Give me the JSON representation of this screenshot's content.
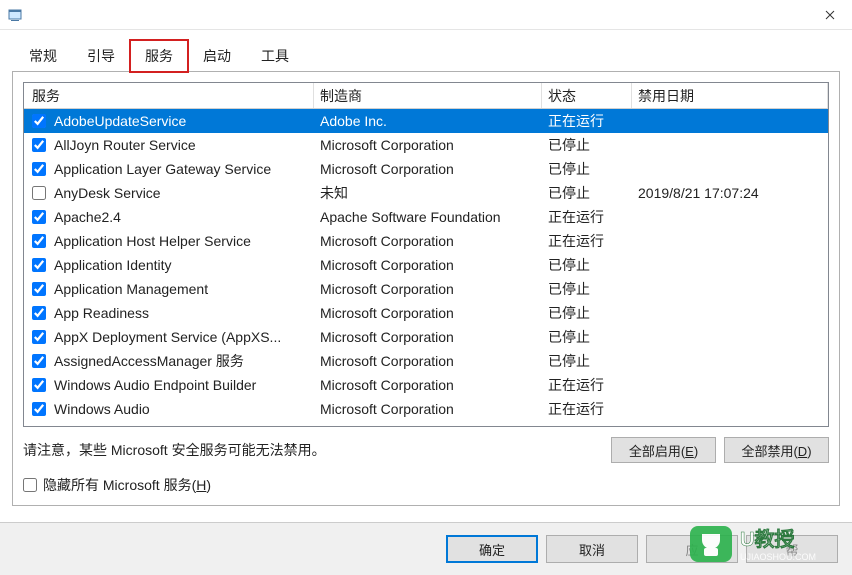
{
  "titlebar": {
    "close_tooltip": "Close"
  },
  "tabs": {
    "items": [
      {
        "label": "常规"
      },
      {
        "label": "引导"
      },
      {
        "label": "服务"
      },
      {
        "label": "启动"
      },
      {
        "label": "工具"
      }
    ],
    "active_index": 2,
    "highlighted_index": 2
  },
  "columns": {
    "service": "服务",
    "vendor": "制造商",
    "status": "状态",
    "disabled_date": "禁用日期"
  },
  "services": [
    {
      "checked": true,
      "selected": true,
      "name": "AdobeUpdateService",
      "vendor": "Adobe Inc.",
      "status": "正在运行",
      "date": ""
    },
    {
      "checked": true,
      "selected": false,
      "name": "AllJoyn Router Service",
      "vendor": "Microsoft Corporation",
      "status": "已停止",
      "date": ""
    },
    {
      "checked": true,
      "selected": false,
      "name": "Application Layer Gateway Service",
      "vendor": "Microsoft Corporation",
      "status": "已停止",
      "date": ""
    },
    {
      "checked": false,
      "selected": false,
      "name": "AnyDesk Service",
      "vendor": "未知",
      "status": "已停止",
      "date": "2019/8/21 17:07:24"
    },
    {
      "checked": true,
      "selected": false,
      "name": "Apache2.4",
      "vendor": "Apache Software Foundation",
      "status": "正在运行",
      "date": ""
    },
    {
      "checked": true,
      "selected": false,
      "name": "Application Host Helper Service",
      "vendor": "Microsoft Corporation",
      "status": "正在运行",
      "date": ""
    },
    {
      "checked": true,
      "selected": false,
      "name": "Application Identity",
      "vendor": "Microsoft Corporation",
      "status": "已停止",
      "date": ""
    },
    {
      "checked": true,
      "selected": false,
      "name": "Application Management",
      "vendor": "Microsoft Corporation",
      "status": "已停止",
      "date": ""
    },
    {
      "checked": true,
      "selected": false,
      "name": "App Readiness",
      "vendor": "Microsoft Corporation",
      "status": "已停止",
      "date": ""
    },
    {
      "checked": true,
      "selected": false,
      "name": "AppX Deployment Service (AppXS...",
      "vendor": "Microsoft Corporation",
      "status": "已停止",
      "date": ""
    },
    {
      "checked": true,
      "selected": false,
      "name": "AssignedAccessManager 服务",
      "vendor": "Microsoft Corporation",
      "status": "已停止",
      "date": ""
    },
    {
      "checked": true,
      "selected": false,
      "name": "Windows Audio Endpoint Builder",
      "vendor": "Microsoft Corporation",
      "status": "正在运行",
      "date": ""
    },
    {
      "checked": true,
      "selected": false,
      "name": "Windows Audio",
      "vendor": "Microsoft Corporation",
      "status": "正在运行",
      "date": ""
    }
  ],
  "note_text": "请注意，某些 Microsoft 安全服务可能无法禁用。",
  "buttons": {
    "enable_all": "全部启用(E)",
    "disable_all": "全部禁用(D)",
    "ok": "确定",
    "cancel": "取消",
    "apply": "应",
    "help": "帮"
  },
  "hide_ms_label": "隐藏所有 Microsoft 服务(H)",
  "hide_ms_underline": "H",
  "watermark": {
    "brand": "U教授",
    "url": "UJIAOSHOU.COM"
  }
}
